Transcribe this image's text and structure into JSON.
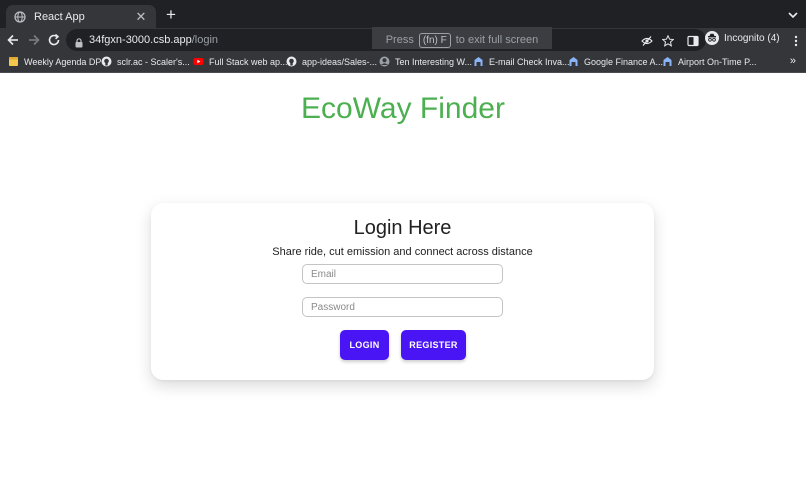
{
  "browser": {
    "tab": {
      "title": "React App",
      "close_glyph": "✕",
      "favicon": "globe-icon"
    },
    "new_tab_glyph": "+",
    "address": {
      "host": "34fgxn-3000.csb.app",
      "path": "/login"
    },
    "fullscreen_hint": {
      "press": "Press",
      "key": "(fn) F",
      "rest": "to exit full screen"
    },
    "profile": {
      "label": "Incognito (4)"
    },
    "bookmarks": [
      {
        "label": "Weekly Agenda DP",
        "icon": "folder-icon"
      },
      {
        "label": "sclr.ac - Scaler's...",
        "icon": "github-icon"
      },
      {
        "label": "Full Stack web ap...",
        "icon": "youtube-icon"
      },
      {
        "label": "app-ideas/Sales-...",
        "icon": "github-icon"
      },
      {
        "label": "Ten Interesting W...",
        "icon": "avatar-icon"
      },
      {
        "label": "E-mail Check Inva...",
        "icon": "app-icon"
      },
      {
        "label": "Google Finance A...",
        "icon": "app-icon"
      },
      {
        "label": "Airport On-Time P...",
        "icon": "app-icon"
      }
    ],
    "bookmarks_more": "»",
    "colors": {
      "tabbar": "#202124",
      "toolbar": "#35363a"
    }
  },
  "page": {
    "brand": "EcoWay Finder",
    "login": {
      "title": "Login Here",
      "subtitle": "Share ride, cut emission and connect across distance",
      "email_placeholder": "Email",
      "password_placeholder": "Password",
      "login_label": "LOGIN",
      "register_label": "REGISTER"
    },
    "colors": {
      "brand": "#4caf50",
      "button": "#4a15f5"
    }
  }
}
